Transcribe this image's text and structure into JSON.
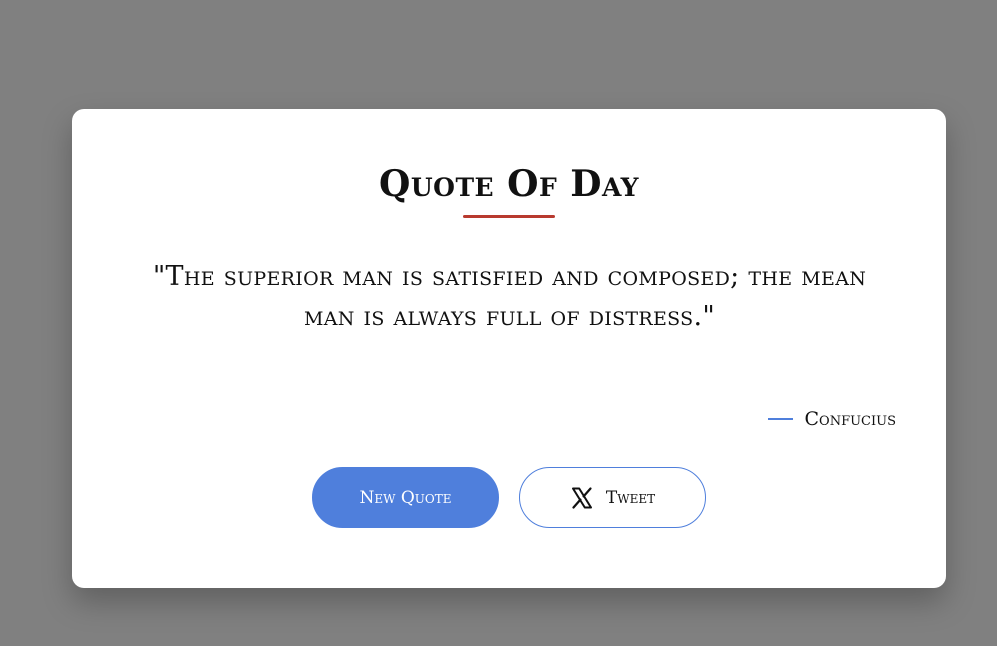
{
  "card": {
    "title": "Quote Of Day",
    "quote_text": "\"The superior man is satisfied and composed; the mean man is always full of distress.\"",
    "author": "Confucius"
  },
  "actions": {
    "new_quote_label": "New Quote",
    "tweet_label": "Tweet",
    "tweet_icon": "x-logo-icon"
  },
  "colors": {
    "background": "#808080",
    "card": "#ffffff",
    "accent": "#4f7fdc",
    "title_underline": "#b83a2f",
    "text": "#111111"
  }
}
